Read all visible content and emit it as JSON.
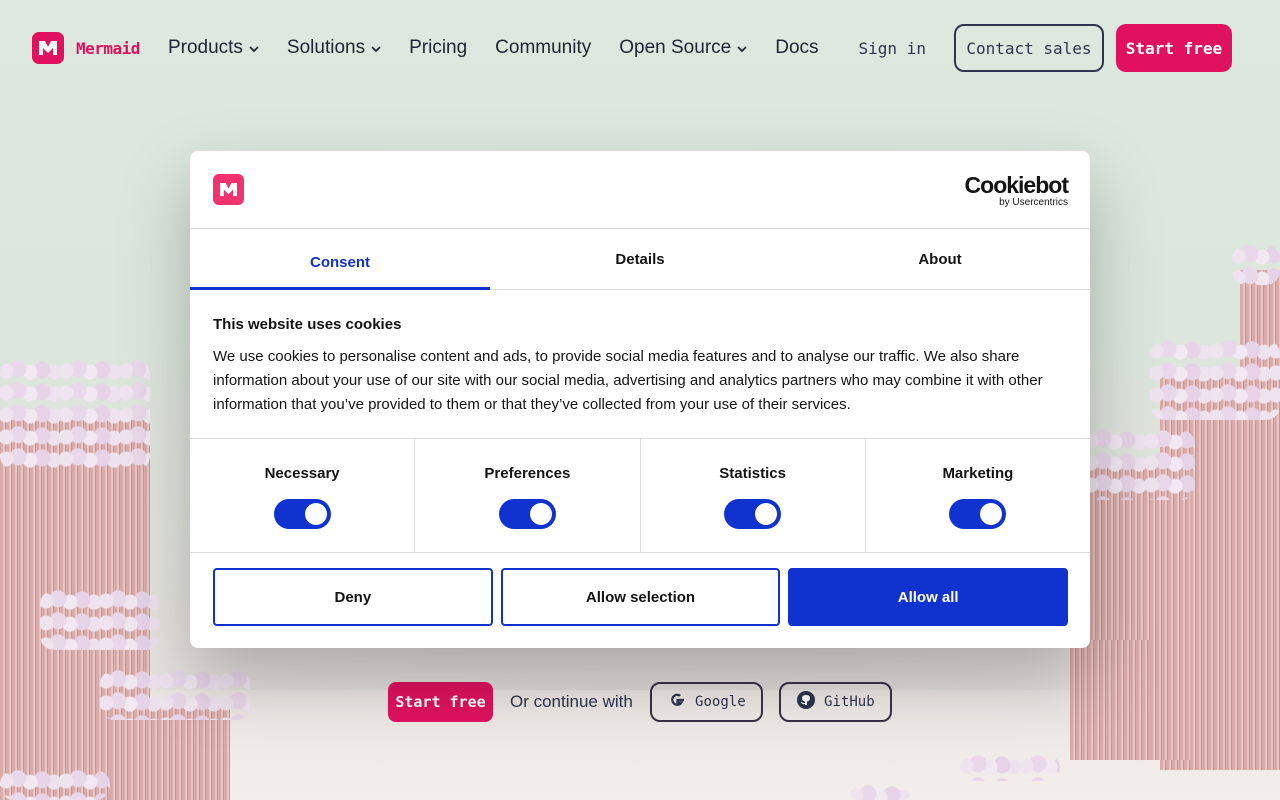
{
  "colors": {
    "brand": "#e0125f",
    "cookie_accent": "#1032cf",
    "text_dark": "#1f2433"
  },
  "nav": {
    "logo_text": "Mermaid",
    "items": [
      {
        "label": "Products",
        "has_dropdown": true
      },
      {
        "label": "Solutions",
        "has_dropdown": true
      },
      {
        "label": "Pricing",
        "has_dropdown": false
      },
      {
        "label": "Community",
        "has_dropdown": false
      },
      {
        "label": "Open Source",
        "has_dropdown": true
      },
      {
        "label": "Docs",
        "has_dropdown": false
      }
    ],
    "sign_in": "Sign in",
    "contact_sales": "Contact sales",
    "start_free": "Start free"
  },
  "hero": {
    "start_free": "Start free",
    "or_continue": "Or continue with",
    "google": "Google",
    "github": "GitHub"
  },
  "cookie_dialog": {
    "brand_word": "Cookiebot",
    "brand_sub": "by Usercentrics",
    "tabs": [
      {
        "label": "Consent",
        "active": true
      },
      {
        "label": "Details",
        "active": false
      },
      {
        "label": "About",
        "active": false
      }
    ],
    "title": "This website uses cookies",
    "body": "We use cookies to personalise content and ads, to provide social media features and to analyse our traffic. We also share information about your use of our site with our social media, advertising and analytics partners who may combine it with other information that you’ve provided to them or that they’ve collected from your use of their services.",
    "toggles": [
      {
        "label": "Necessary",
        "checked": true
      },
      {
        "label": "Preferences",
        "checked": true
      },
      {
        "label": "Statistics",
        "checked": true
      },
      {
        "label": "Marketing",
        "checked": true
      }
    ],
    "buttons": {
      "deny": "Deny",
      "allow_selection": "Allow selection",
      "allow_all": "Allow all"
    }
  }
}
